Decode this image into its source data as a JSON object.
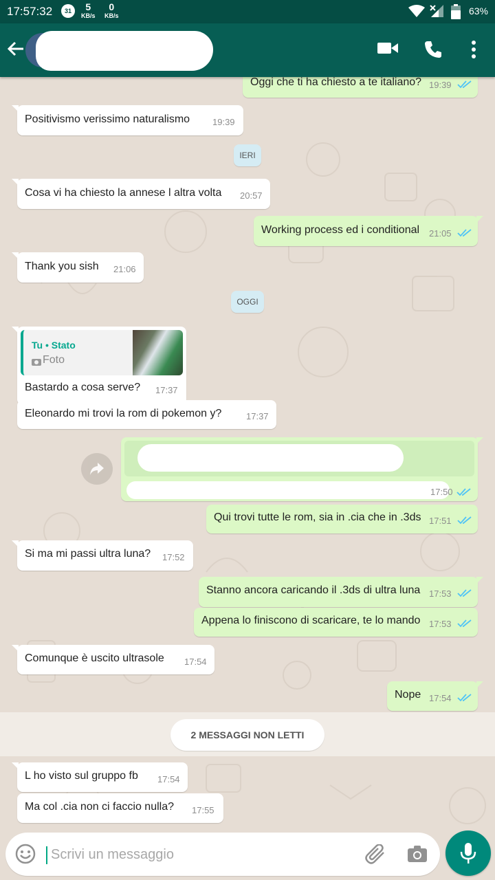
{
  "status_bar": {
    "time": "17:57:32",
    "calendar_day": "31",
    "net_up_value": "5",
    "net_down_value": "0",
    "net_unit": "KB/s",
    "battery": "63%"
  },
  "header": {
    "contact_name": "",
    "video_call_icon": "video-camera-icon",
    "voice_call_icon": "phone-icon",
    "menu_icon": "more-vert-icon"
  },
  "day_chips": {
    "yesterday": "IERI",
    "today": "OGGI"
  },
  "messages": [
    {
      "dir": "out",
      "text": "Oggi che ti ha chiesto a te italiano?",
      "time": "19:39",
      "read": true
    },
    {
      "dir": "in",
      "text": "Positivismo  verissimo  naturalismo",
      "time": "19:39"
    },
    {
      "dir": "in",
      "text": "Cosa vi ha chiesto  la annese  l altra volta",
      "time": "20:57"
    },
    {
      "dir": "out",
      "text": "Working process ed i conditional",
      "time": "21:05",
      "read": true
    },
    {
      "dir": "in",
      "text": "Thank  you sish",
      "time": "21:06"
    },
    {
      "dir": "in",
      "text": "Bastardo  a cosa serve?",
      "time": "17:37",
      "quote_author": "Tu • Stato",
      "quote_type": "Foto"
    },
    {
      "dir": "in",
      "text": "Eleonardo  mi trovi  la rom  di pokemon  y?",
      "time": "17:37"
    },
    {
      "dir": "out",
      "text": "",
      "time": "17:50",
      "read": true,
      "redacted_link": true
    },
    {
      "dir": "out",
      "text": "Qui trovi tutte le rom, sia in .cia che in .3ds",
      "time": "17:51",
      "read": true
    },
    {
      "dir": "in",
      "text": "Si ma mi passi ultra luna?",
      "time": "17:52"
    },
    {
      "dir": "out",
      "text": "Stanno ancora caricando il .3ds di ultra luna",
      "time": "17:53",
      "read": true
    },
    {
      "dir": "out",
      "text": "Appena lo finiscono di scaricare, te lo mando",
      "time": "17:53",
      "read": true
    },
    {
      "dir": "in",
      "text": "Comunque  è uscito  ultrasole",
      "time": "17:54"
    },
    {
      "dir": "out",
      "text": "Nope",
      "time": "17:54",
      "read": true
    },
    {
      "dir": "in",
      "text": "L ho visto  sul gruppo  fb",
      "time": "17:54"
    },
    {
      "dir": "in",
      "text": "Ma col .cia non ci faccio  nulla?",
      "time": "17:55"
    }
  ],
  "unread_banner": "2 MESSAGGI NON LETTI",
  "input": {
    "placeholder": "Scrivi un messaggio"
  },
  "colors": {
    "header": "#075e54",
    "status_bar": "#054d44",
    "outgoing_bubble": "#dcf8c6",
    "incoming_bubble": "#ffffff",
    "read_ticks": "#4fc3f7",
    "mic_button": "#00897b"
  }
}
